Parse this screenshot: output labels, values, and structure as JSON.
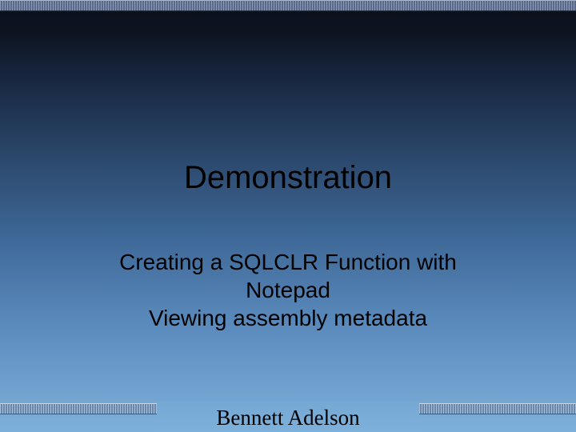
{
  "title": "Demonstration",
  "body": {
    "line1": "Creating a SQLCLR Function with",
    "line2": "Notepad",
    "line3": "Viewing assembly metadata"
  },
  "footer": {
    "name": "Bennett Adelson"
  }
}
